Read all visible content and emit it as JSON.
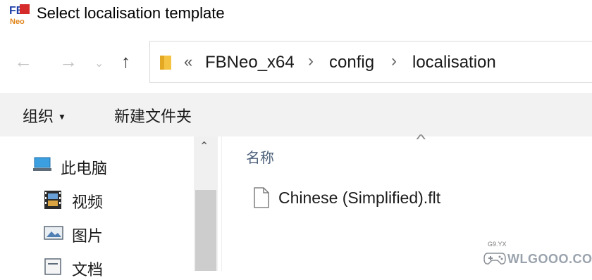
{
  "window": {
    "title": "Select localisation template",
    "app_icon": "fbneo-app-icon"
  },
  "navigation": {
    "back_glyph": "←",
    "forward_glyph": "→",
    "recent_glyph": "⌄",
    "up_glyph": "↑",
    "path_overflow": "«",
    "separator": "›",
    "breadcrumbs": [
      "FBNeo_x64",
      "config",
      "localisation"
    ]
  },
  "command_bar": {
    "organize_label": "组织",
    "organize_arrow": "▼",
    "new_folder_label": "新建文件夹"
  },
  "nav_pane": {
    "items": [
      {
        "label": "此电脑",
        "icon": "this-pc-icon"
      },
      {
        "label": "视频",
        "icon": "videos-icon"
      },
      {
        "label": "图片",
        "icon": "pictures-icon"
      },
      {
        "label": "文档",
        "icon": "documents-icon"
      }
    ],
    "scroll_up_glyph": "⌃"
  },
  "file_list": {
    "column_name": "名称",
    "sort_glyph": "^",
    "files": [
      {
        "name": "Chinese (Simplified).flt",
        "icon": "file-icon"
      }
    ]
  },
  "watermark": {
    "text": "WLGOOO.COM",
    "small_text": "G9.YX"
  },
  "colors": {
    "command_bar_bg": "#f2f2f2",
    "column_header": "#4c607a",
    "folder_yellow": "#f5c342",
    "scroll_thumb": "#cdcdcd"
  }
}
